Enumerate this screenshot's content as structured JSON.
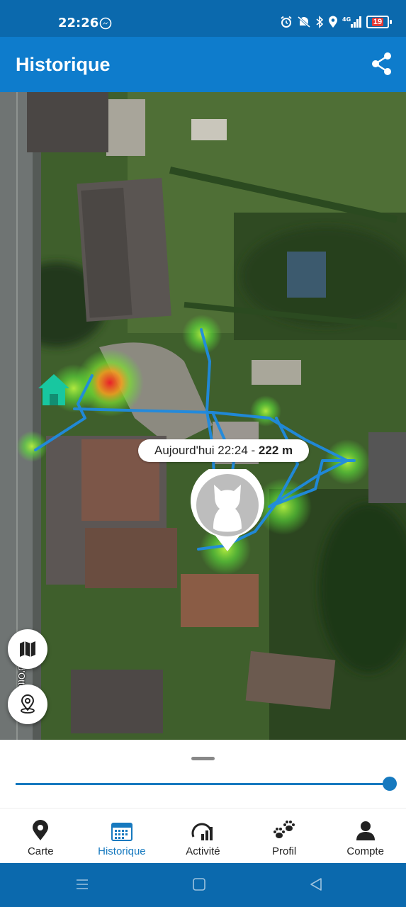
{
  "status_bar": {
    "time": "22:26",
    "battery_level": "19",
    "icons": [
      "messenger-icon",
      "alarm-icon",
      "mute-icon",
      "bluetooth-icon",
      "location-icon",
      "signal-4g-icon",
      "battery-icon"
    ]
  },
  "app_bar": {
    "title": "Historique",
    "share_icon": "share-icon"
  },
  "map": {
    "street_label": "Chau. d'Ottenbourg",
    "callout": {
      "time": "Aujourd'hui 22:24",
      "separator": " - ",
      "distance": "222 m"
    },
    "track_color": "#1f8be0",
    "heat_hot_color": "#e8202a",
    "heat_cool_color": "#5ee23a",
    "home_color": "#18c7a0"
  },
  "timeline": {
    "slider_position_fraction": 1.0
  },
  "bottom_nav": [
    {
      "label": "Carte",
      "icon": "map-pin-icon",
      "active": false
    },
    {
      "label": "Historique",
      "icon": "calendar-icon",
      "active": true
    },
    {
      "label": "Activité",
      "icon": "activity-gauge-icon",
      "active": false
    },
    {
      "label": "Profil",
      "icon": "paw-icon",
      "active": false
    },
    {
      "label": "Compte",
      "icon": "person-icon",
      "active": false
    }
  ],
  "colors": {
    "primary": "#0e7ccc",
    "status_bar": "#0b69ad",
    "accent": "#1679bf"
  }
}
